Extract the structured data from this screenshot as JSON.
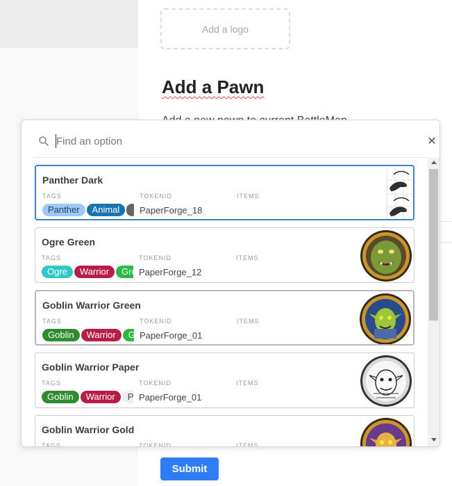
{
  "form": {
    "logo_placeholder": "Add a logo",
    "title": "Add a Pawn",
    "subtitle": "Add a new pawn to current BattleMap",
    "submit_label": "Submit"
  },
  "search": {
    "placeholder": "Find an option",
    "value": ""
  },
  "column_labels": {
    "tags": "TAGS",
    "tokenid": "TOKENID",
    "items": "ITEMS"
  },
  "options": [
    {
      "name": "Panther Dark",
      "tokenid": "PaperForge_18",
      "state": "selected",
      "thumb": "panther-icon",
      "tags": [
        {
          "label": "Panther",
          "color": "#9ec9f6",
          "text_color": "#1d3f66"
        },
        {
          "label": "Animal",
          "color": "#1a72b2",
          "text_color": "#ffffff"
        },
        {
          "label": "",
          "color": "#666666",
          "text_color": "#ffffff"
        }
      ]
    },
    {
      "name": "Ogre Green",
      "tokenid": "PaperForge_12",
      "state": "normal",
      "thumb": "ogre-token-icon",
      "tags": [
        {
          "label": "Ogre",
          "color": "#2ec8c8",
          "text_color": "#ffffff"
        },
        {
          "label": "Warrior",
          "color": "#b81e45",
          "text_color": "#ffffff"
        },
        {
          "label": "Green",
          "color": "#2bb845",
          "text_color": "#ffffff"
        }
      ]
    },
    {
      "name": "Goblin Warrior Green",
      "tokenid": "PaperForge_01",
      "state": "hovered",
      "thumb": "goblin-green-token-icon",
      "tags": [
        {
          "label": "Goblin",
          "color": "#2e8b2e",
          "text_color": "#ffffff"
        },
        {
          "label": "Warrior",
          "color": "#b81e45",
          "text_color": "#ffffff"
        },
        {
          "label": "Green",
          "color": "#2bb845",
          "text_color": "#ffffff"
        }
      ]
    },
    {
      "name": "Goblin Warrior Paper",
      "tokenid": "PaperForge_01",
      "state": "normal",
      "thumb": "goblin-paper-token-icon",
      "tags": [
        {
          "label": "Goblin",
          "color": "#2e8b2e",
          "text_color": "#ffffff"
        },
        {
          "label": "Warrior",
          "color": "#b81e45",
          "text_color": "#ffffff"
        },
        {
          "label": "Paper",
          "color": "#eeeeee",
          "text_color": "#444444"
        }
      ]
    },
    {
      "name": "Goblin Warrior Gold",
      "tokenid": "",
      "state": "normal",
      "thumb": "goblin-gold-token-icon",
      "tags": []
    }
  ]
}
